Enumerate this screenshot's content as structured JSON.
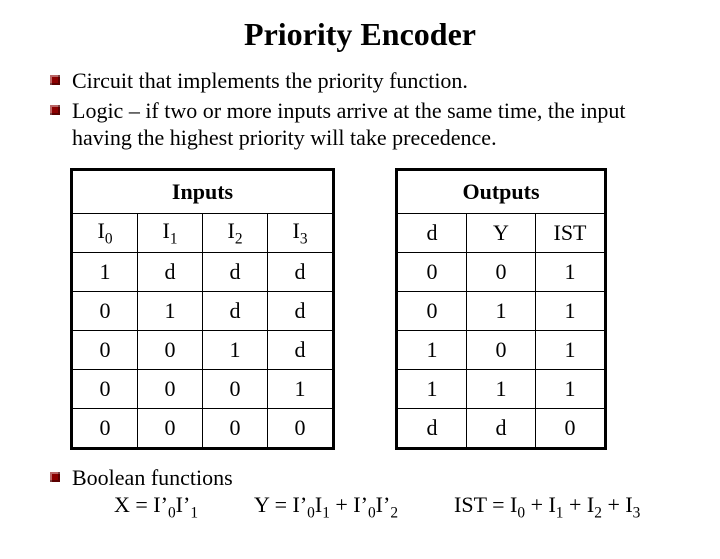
{
  "title": "Priority Encoder",
  "bullets": [
    "Circuit that implements the priority function.",
    "Logic – if two or more inputs arrive at the same time, the input having the highest priority will take precedence."
  ],
  "inputs": {
    "group_label": "Inputs",
    "headers": [
      "I0",
      "I1",
      "I2",
      "I3"
    ],
    "rows": [
      [
        "1",
        "d",
        "d",
        "d"
      ],
      [
        "0",
        "1",
        "d",
        "d"
      ],
      [
        "0",
        "0",
        "1",
        "d"
      ],
      [
        "0",
        "0",
        "0",
        "1"
      ],
      [
        "0",
        "0",
        "0",
        "0"
      ]
    ]
  },
  "outputs": {
    "group_label": "Outputs",
    "headers": [
      "d",
      "Y",
      "IST"
    ],
    "rows": [
      [
        "0",
        "0",
        "1"
      ],
      [
        "0",
        "1",
        "1"
      ],
      [
        "1",
        "0",
        "1"
      ],
      [
        "1",
        "1",
        "1"
      ],
      [
        "d",
        "d",
        "0"
      ]
    ]
  },
  "bool_heading": "Boolean functions",
  "equations": {
    "x": "X = I’0I’1",
    "y": "Y = I’0I1 + I’0I’2",
    "ist": "IST = I0 + I1 + I2 + I3"
  },
  "chart_data": {
    "type": "table",
    "title": "Priority Encoder truth table",
    "tables": [
      {
        "name": "Inputs",
        "columns": [
          "I0",
          "I1",
          "I2",
          "I3"
        ],
        "rows": [
          [
            "1",
            "d",
            "d",
            "d"
          ],
          [
            "0",
            "1",
            "d",
            "d"
          ],
          [
            "0",
            "0",
            "1",
            "d"
          ],
          [
            "0",
            "0",
            "0",
            "1"
          ],
          [
            "0",
            "0",
            "0",
            "0"
          ]
        ]
      },
      {
        "name": "Outputs",
        "columns": [
          "d",
          "Y",
          "IST"
        ],
        "rows": [
          [
            "0",
            "0",
            "1"
          ],
          [
            "0",
            "1",
            "1"
          ],
          [
            "1",
            "0",
            "1"
          ],
          [
            "1",
            "1",
            "1"
          ],
          [
            "d",
            "d",
            "0"
          ]
        ]
      }
    ]
  }
}
